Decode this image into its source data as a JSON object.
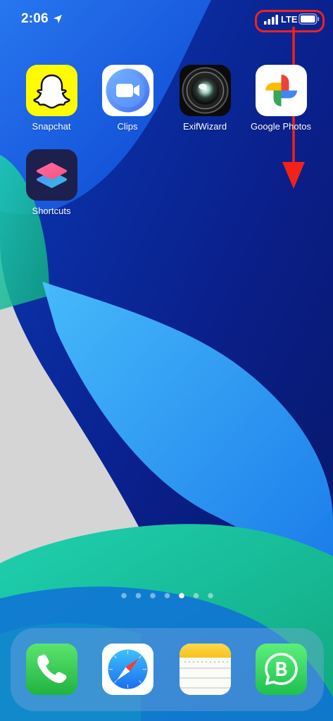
{
  "status_bar": {
    "time": "2:06",
    "network": "LTE",
    "location_icon": "location-arrow-icon",
    "signal_icon": "cellular-signal-icon",
    "battery_icon": "battery-icon"
  },
  "annotation": {
    "color": "#f2221a",
    "shape": "rounded-rectangle-highlight",
    "arrow_direction": "down"
  },
  "home_apps": [
    {
      "label": "Snapchat",
      "icon": "snapchat-ghost-icon"
    },
    {
      "label": "Clips",
      "icon": "clips-camera-icon"
    },
    {
      "label": "ExifWizard",
      "icon": "exifwizard-lens-icon"
    },
    {
      "label": "Google Photos",
      "icon": "google-photos-pinwheel-icon"
    },
    {
      "label": "Shortcuts",
      "icon": "shortcuts-layers-icon"
    }
  ],
  "page_indicator": {
    "total": 7,
    "current": 5
  },
  "dock_apps": [
    {
      "name": "Phone",
      "icon": "phone-handset-icon"
    },
    {
      "name": "Safari",
      "icon": "safari-compass-icon"
    },
    {
      "name": "Notes",
      "icon": "notes-paper-icon"
    },
    {
      "name": "WhatsApp Business",
      "icon": "whatsapp-business-icon"
    }
  ],
  "colors": {
    "wallpaper_deep_blue": "#0a2a8c",
    "wallpaper_mid_blue": "#1f6ff0",
    "wallpaper_light_blue": "#38b6ff",
    "wallpaper_teal": "#19c6a0",
    "wallpaper_gray": "#d4d4d4",
    "snapchat_yellow": "#fffc00",
    "phone_green": "#34c759",
    "whatsapp_green": "#25d366"
  }
}
